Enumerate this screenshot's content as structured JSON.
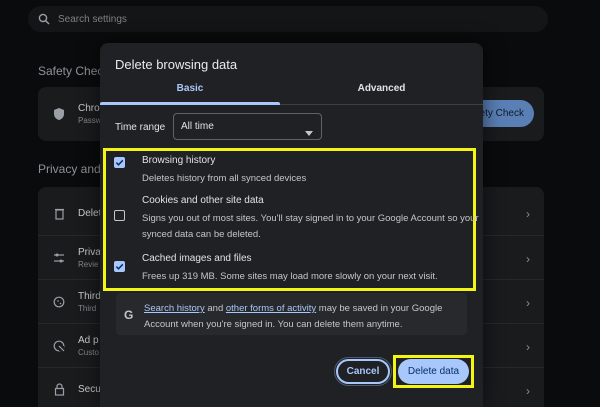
{
  "background": {
    "search_placeholder": "Search settings",
    "safety_check": {
      "title": "Safety Check",
      "row_title": "Chro",
      "row_sub": "Passw",
      "button_label": "fety Check"
    },
    "privacy": {
      "title": "Privacy and s",
      "rows": [
        {
          "title": "Delet",
          "sub": "",
          "icon": "trash-icon"
        },
        {
          "title": "Priva",
          "sub": "Revie",
          "icon": "tune-icon"
        },
        {
          "title": "Third",
          "sub": "Third",
          "icon": "cookie-icon"
        },
        {
          "title": "Ad p",
          "sub": "Custo",
          "icon": "ad-icon"
        },
        {
          "title": "Secu",
          "sub": "",
          "icon": "lock-icon"
        }
      ]
    }
  },
  "dialog": {
    "title": "Delete browsing data",
    "tabs": [
      {
        "label": "Basic",
        "active": true
      },
      {
        "label": "Advanced",
        "active": false
      }
    ],
    "time_range": {
      "label": "Time range",
      "value": "All time"
    },
    "options": [
      {
        "title": "Browsing history",
        "description": "Deletes history from all synced devices",
        "checked": true
      },
      {
        "title": "Cookies and other site data",
        "description": "Signs you out of most sites. You'll stay signed in to your Google Account so your synced data can be deleted.",
        "checked": false
      },
      {
        "title": "Cached images and files",
        "description": "Frees up 319 MB. Some sites may load more slowly on your next visit.",
        "checked": true
      }
    ],
    "note": {
      "link1": "Search history",
      "mid1": " and ",
      "link2": "other forms of activity",
      "rest": " may be saved in your Google Account when you're signed in. You can delete them anytime."
    },
    "cancel_label": "Cancel",
    "delete_label": "Delete data"
  },
  "colors": {
    "accent": "#a8c7fa",
    "highlight": "#f4f512",
    "dialog_bg": "#202124"
  }
}
